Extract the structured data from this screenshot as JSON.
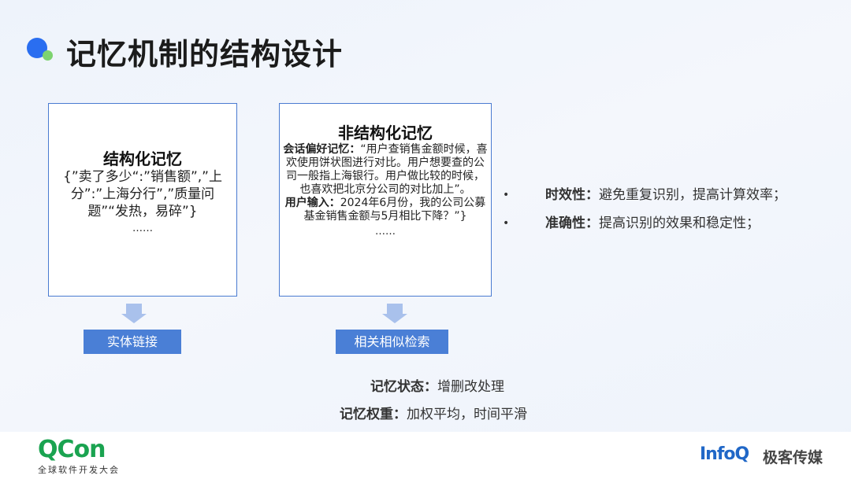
{
  "title": "记忆机制的结构设计",
  "structured": {
    "heading": "结构化记忆",
    "body": "{”卖了多少“:”销售额”,”上分”:”上海分行”,”质量问题”“发热，易碎”}",
    "ellipsis": "……"
  },
  "unstructured": {
    "heading": "非结构化记忆",
    "pref_label": "会话偏好记忆：",
    "pref_text": "“用户查销售金额时候，喜欢使用饼状图进行对比。用户想要查的公司一般指上海银行。用户做比较的时候，也喜欢把北京分公司的对比加上”。",
    "input_label": "用户输入：",
    "input_text": "2024年6月份，我的公司公募基金销售金额与5月相比下降？”}",
    "ellipsis": "……"
  },
  "tags": {
    "entity_link": "实体链接",
    "similar_search": "相关相似检索"
  },
  "bullets": [
    {
      "label": "时效性：",
      "text": "避免重复识别，提高计算效率；"
    },
    {
      "label": "准确性：",
      "text": "提高识别的效果和稳定性；"
    }
  ],
  "bullet_glyph": "•",
  "memory_state": {
    "label": "记忆状态：",
    "text": "增删改处理"
  },
  "memory_weight": {
    "label": "记忆权重：",
    "text": "加权平均，时间平滑"
  },
  "footer": {
    "qcon": "QCon",
    "qcon_sub": "全球软件开发大会",
    "infoq": "InfoQ",
    "infoq_cn": "极客传媒"
  },
  "colors": {
    "accent_blue": "#4a7fd6",
    "border_blue": "#4a7bd1",
    "arrow_blue": "#a9c1ec",
    "qcon_green": "#1aa350",
    "infoq_blue": "#2067c7"
  }
}
